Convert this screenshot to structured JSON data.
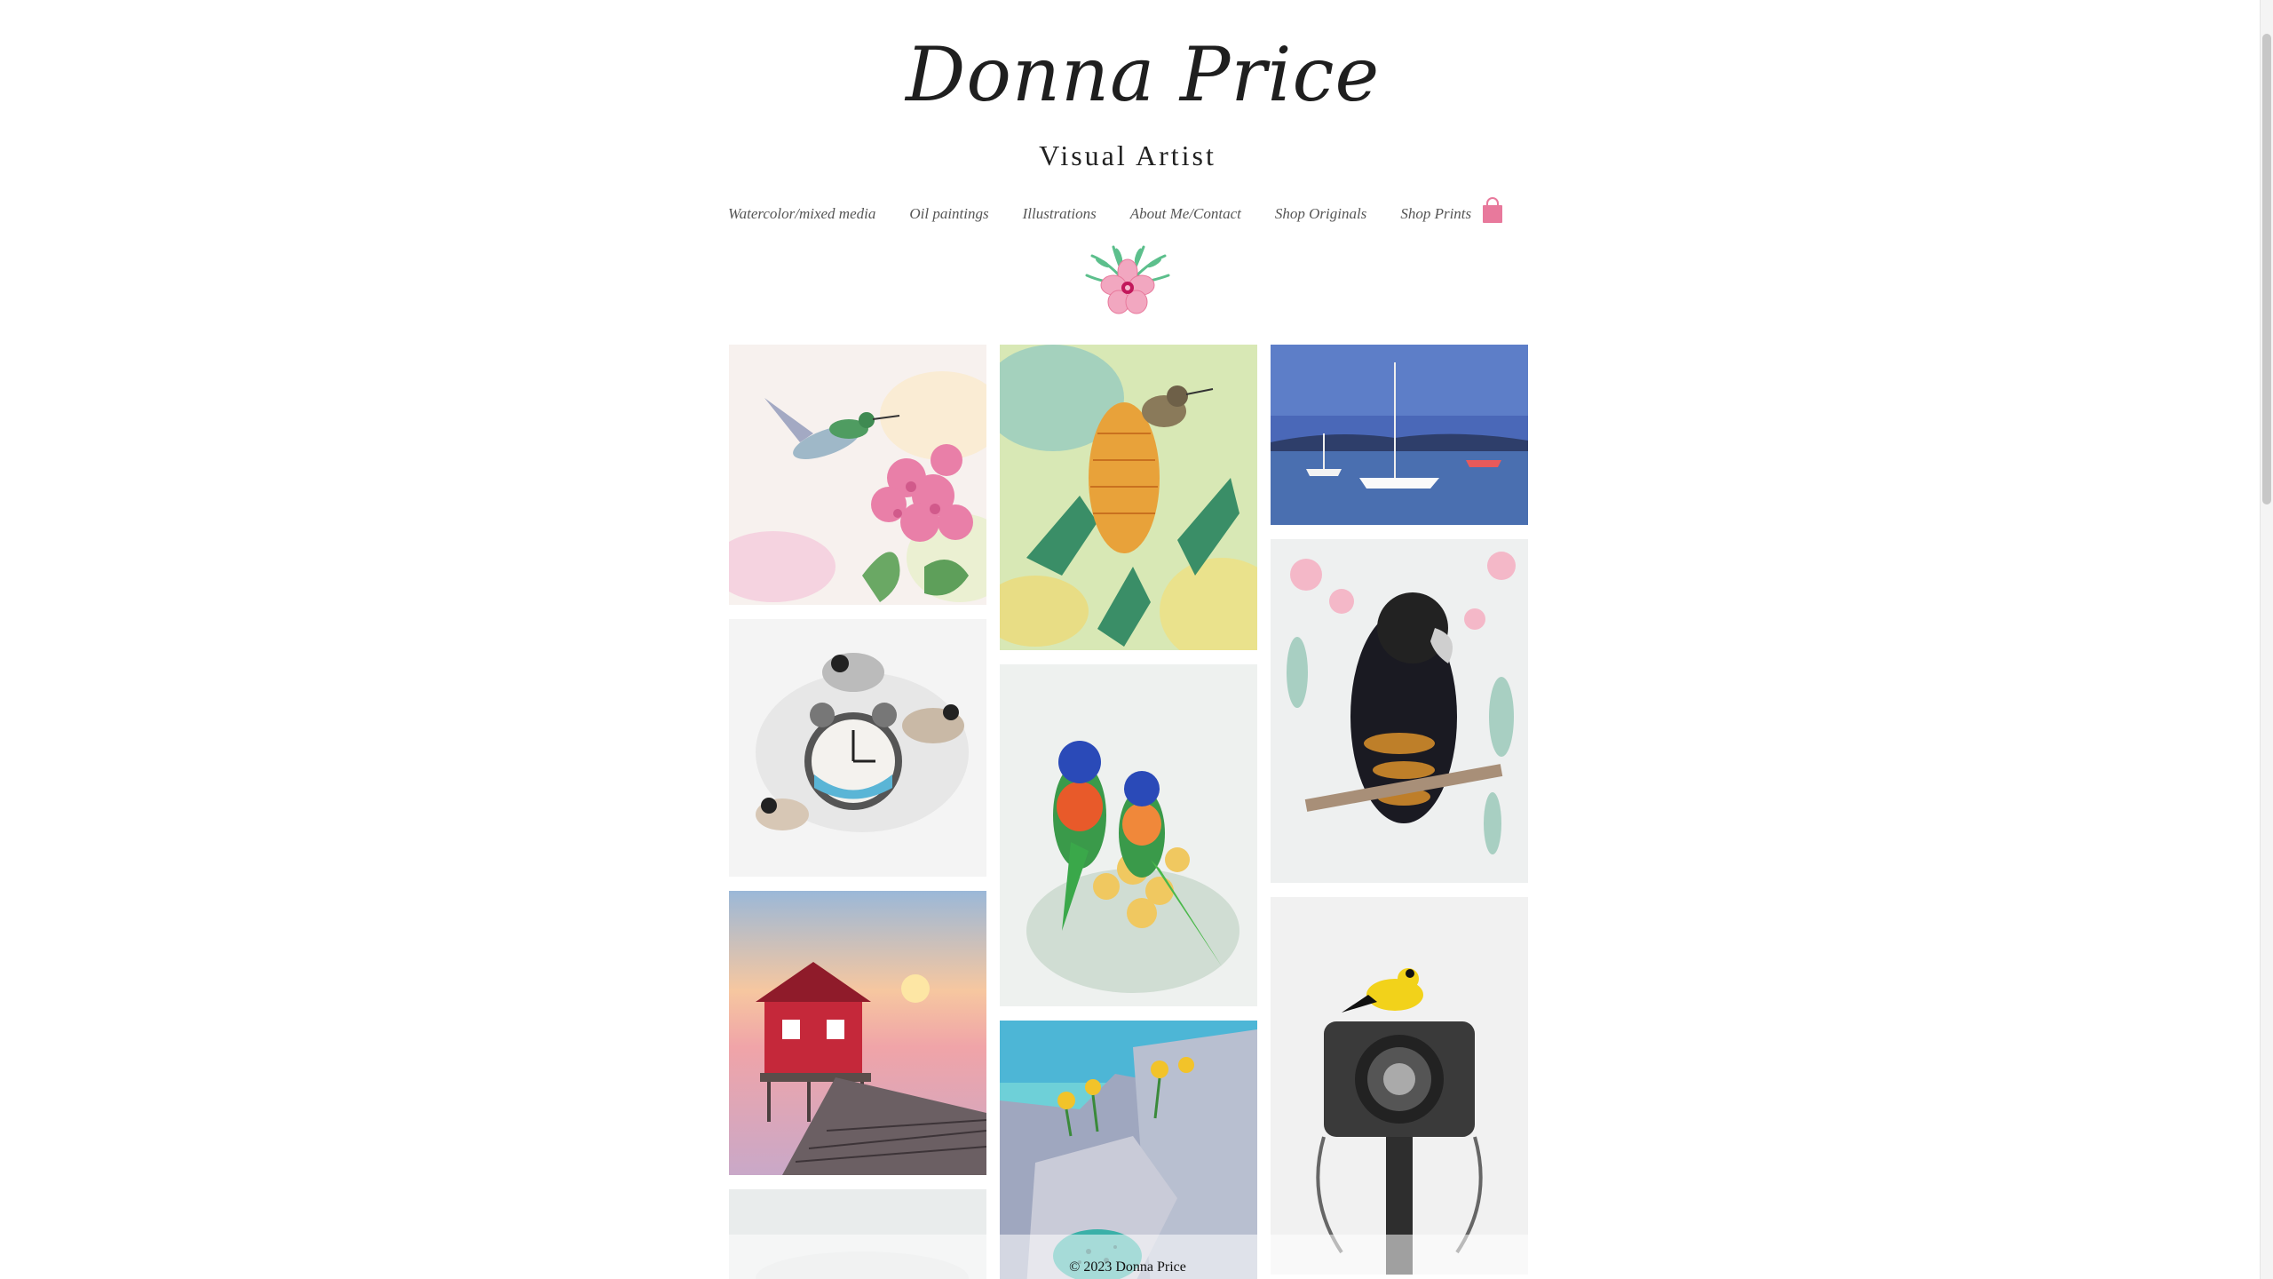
{
  "header": {
    "title": "Donna Price",
    "subtitle": "Visual Artist"
  },
  "nav": {
    "items": [
      "Watercolor/mixed media",
      "Oil paintings",
      "Illustrations",
      "About Me/Contact",
      "Shop Originals",
      "Shop Prints"
    ]
  },
  "icons": {
    "cart": "shopping-bag-icon",
    "flower": "pink-flower-icon"
  },
  "colors": {
    "accent_pink": "#e8799c",
    "leaf_green": "#5cbf8c",
    "text": "#222222"
  },
  "gallery": {
    "paintings": [
      "hummingbird-with-pink-flowers",
      "bird-on-banksia",
      "sailboats-on-bay",
      "chickadees-with-alarm-clock",
      "rainbow-lorikeets",
      "black-cockatoo-on-branch",
      "red-boathouse-on-jetty",
      "wildflowers-on-rocks-with-egg",
      "goldfinch-on-camera",
      "misty-landscape"
    ]
  },
  "footer": {
    "copyright": "© 2023 Donna Price"
  }
}
